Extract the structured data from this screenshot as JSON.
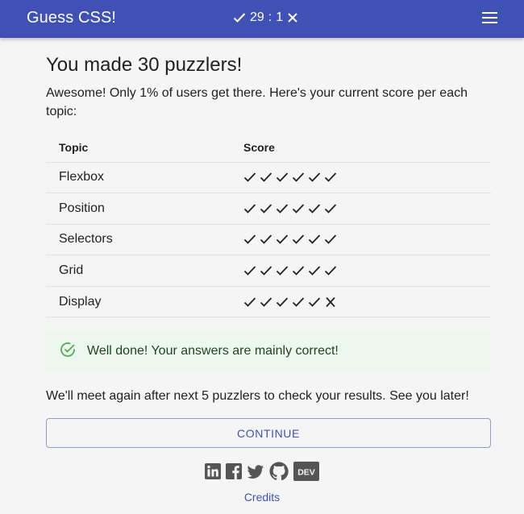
{
  "header": {
    "brand": "Guess CSS!",
    "correct_count": "29",
    "separator": ":",
    "wrong_count": "1",
    "menu_icon": "menu-icon"
  },
  "main": {
    "title": "You made 30 puzzlers!",
    "intro": "Awesome! Only 1% of users get there. Here's your current score per each topic:",
    "table": {
      "headers": [
        "Topic",
        "Score"
      ],
      "rows": [
        {
          "topic": "Flexbox",
          "score": [
            "correct",
            "correct",
            "correct",
            "correct",
            "correct",
            "correct"
          ]
        },
        {
          "topic": "Position",
          "score": [
            "correct",
            "correct",
            "correct",
            "correct",
            "correct",
            "correct"
          ]
        },
        {
          "topic": "Selectors",
          "score": [
            "correct",
            "correct",
            "correct",
            "correct",
            "correct",
            "correct"
          ]
        },
        {
          "topic": "Grid",
          "score": [
            "correct",
            "correct",
            "correct",
            "correct",
            "correct",
            "correct"
          ]
        },
        {
          "topic": "Display",
          "score": [
            "correct",
            "correct",
            "correct",
            "correct",
            "correct",
            "wrong"
          ]
        }
      ]
    },
    "alert": {
      "icon": "check-circle-icon",
      "text": "Well done! Your answers are mainly correct!"
    },
    "outro": "We'll meet again after next 5 puzzlers to check your results. See you later!",
    "continue_label": "CONTINUE"
  },
  "footer": {
    "social": [
      "linkedin-icon",
      "facebook-icon",
      "twitter-icon",
      "github-icon",
      "dev-icon"
    ],
    "dev_label": "DEV",
    "credits_label": "Credits"
  },
  "colors": {
    "primary": "#3f51b5",
    "alert_bg": "#edf7ed",
    "alert_text": "#1e4620",
    "alert_icon": "#4caf50"
  }
}
